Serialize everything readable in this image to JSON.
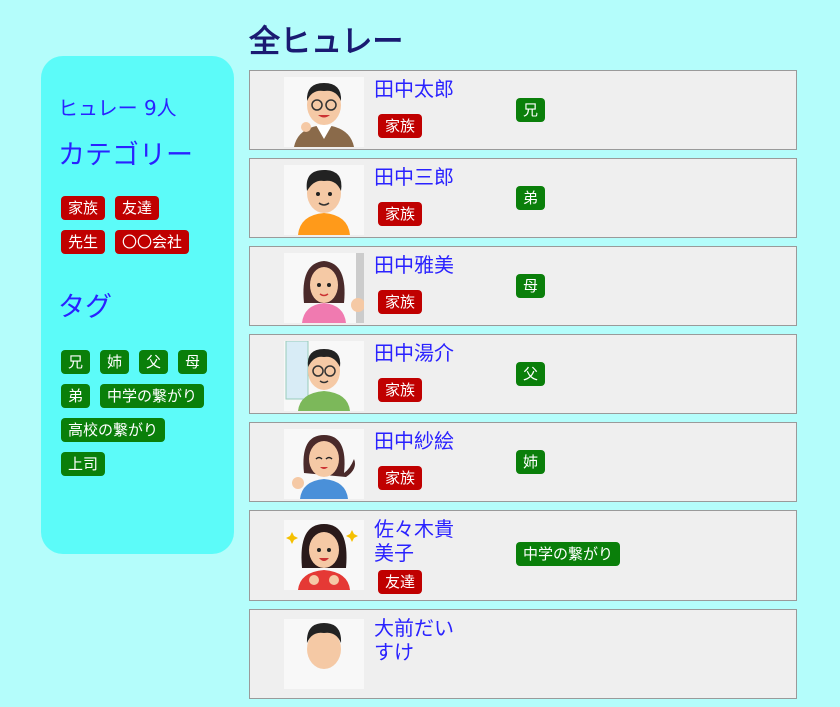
{
  "sidebar": {
    "count_title": "ヒュレー 9人",
    "categories_title": "カテゴリー",
    "categories": [
      "家族",
      "友達",
      "先生",
      "〇〇会社"
    ],
    "tags_title": "タグ",
    "tags": [
      "兄",
      "姉",
      "父",
      "母",
      "弟",
      "中学の繋がり",
      "高校の繋がり",
      "上司"
    ]
  },
  "main": {
    "title": "全ヒュレー",
    "people": [
      {
        "name": "田中太郎",
        "category": "家族",
        "tag": "兄",
        "icon": "man-glasses-icon"
      },
      {
        "name": "田中三郎",
        "category": "家族",
        "tag": "弟",
        "icon": "boy-icon"
      },
      {
        "name": "田中雅美",
        "category": "家族",
        "tag": "母",
        "icon": "woman-icon"
      },
      {
        "name": "田中湯介",
        "category": "家族",
        "tag": "父",
        "icon": "father-glasses-icon"
      },
      {
        "name": "田中紗絵",
        "category": "家族",
        "tag": "姉",
        "icon": "girl-pointing-icon"
      },
      {
        "name": "佐々木貴美子",
        "category": "友達",
        "tag": "中学の繋がり",
        "icon": "girl-happy-icon"
      },
      {
        "name": "大前だいすけ",
        "category": "",
        "tag": "",
        "icon": "man-icon"
      }
    ]
  },
  "colors": {
    "background": "#b4fdfb",
    "sidebar": "#5cfbf9",
    "link": "#2a22ff",
    "category_chip": "#c00000",
    "tag_chip": "#0a7f0a"
  }
}
